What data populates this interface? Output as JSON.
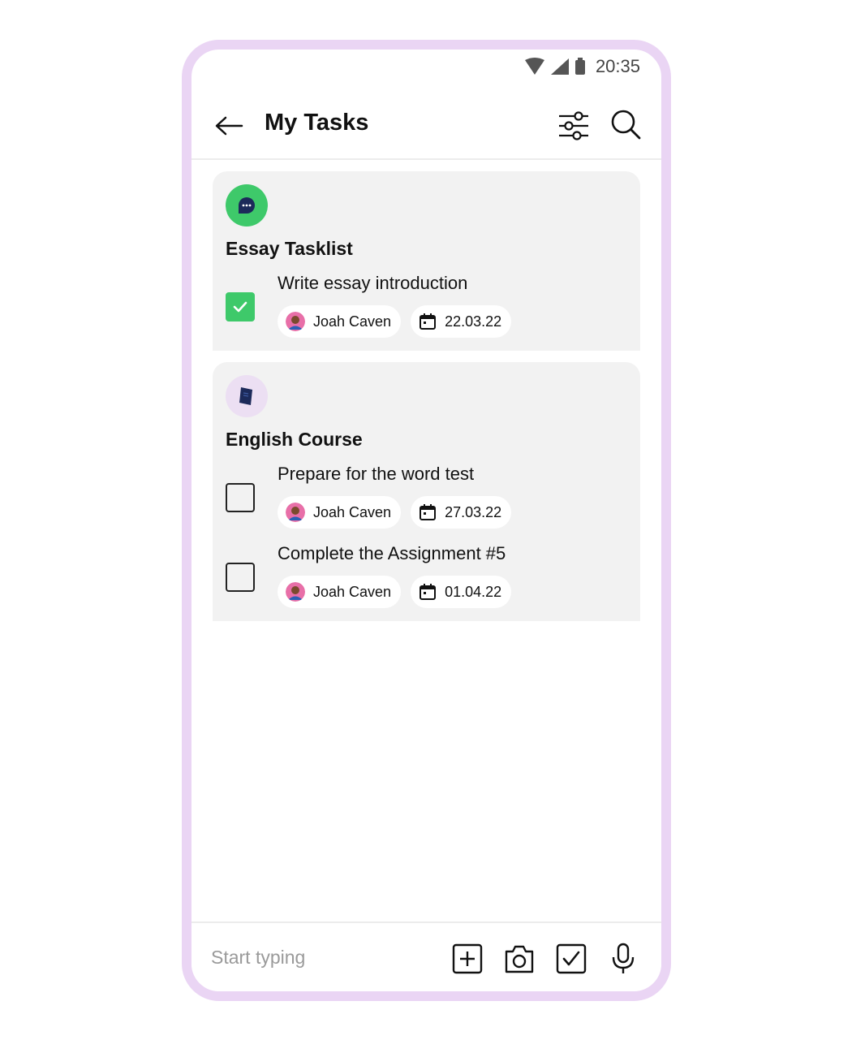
{
  "status_bar": {
    "time": "20:35"
  },
  "app_bar": {
    "title": "My Tasks"
  },
  "lists": [
    {
      "title": "Essay Tasklist",
      "icon": "chat-bubble-icon",
      "accent": "#3ec96a",
      "tasks": [
        {
          "title": "Write essay introduction",
          "checked": true,
          "assignee": "Joah Caven",
          "date": "22.03.22"
        }
      ]
    },
    {
      "title": "English Course",
      "icon": "book-icon",
      "accent": "#ecdff3",
      "tasks": [
        {
          "title": "Prepare for the word test",
          "checked": false,
          "assignee": "Joah Caven",
          "date": "27.03.22"
        },
        {
          "title": "Complete the Assignment #5",
          "checked": false,
          "assignee": "Joah Caven",
          "date": "01.04.22"
        }
      ]
    }
  ],
  "composer": {
    "placeholder": "Start typing"
  },
  "colors": {
    "frame": "#ead5f4",
    "card": "#f2f2f2",
    "check": "#3ec96a"
  }
}
